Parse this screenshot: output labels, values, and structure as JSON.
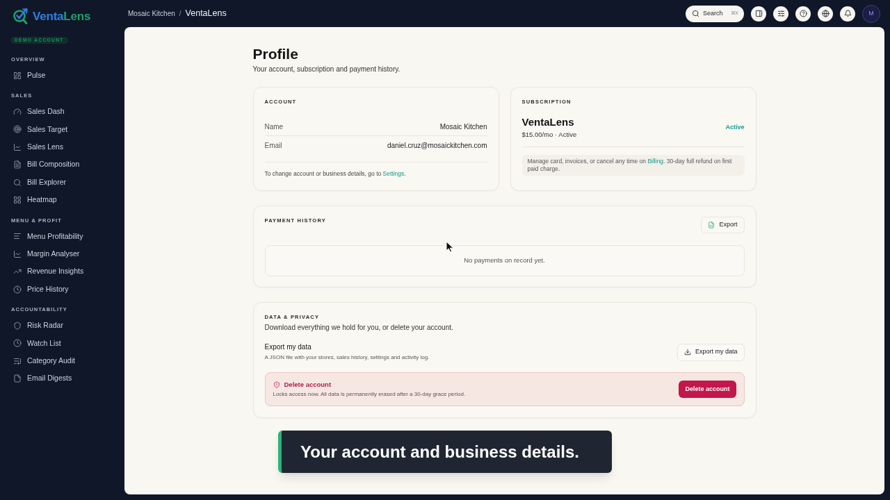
{
  "sidebar": {
    "brand": {
      "lead": "Venta",
      "tail": "Lens"
    },
    "badge": "DEMO ACCOUNT",
    "sections": [
      {
        "title": "OVERVIEW",
        "items": [
          {
            "label": "Pulse"
          }
        ]
      },
      {
        "title": "SALES",
        "items": [
          {
            "label": "Sales Dash"
          },
          {
            "label": "Sales Target"
          },
          {
            "label": "Sales Lens"
          },
          {
            "label": "Bill Composition"
          },
          {
            "label": "Bill Explorer"
          },
          {
            "label": "Heatmap"
          }
        ]
      },
      {
        "title": "MENU & PROFIT",
        "items": [
          {
            "label": "Menu Profitability"
          },
          {
            "label": "Margin Analyser"
          },
          {
            "label": "Revenue Insights"
          },
          {
            "label": "Price History"
          }
        ]
      },
      {
        "title": "ACCOUNTABILITY",
        "items": [
          {
            "label": "Risk Radar"
          },
          {
            "label": "Watch List"
          },
          {
            "label": "Category Audit"
          },
          {
            "label": "Email Digests"
          }
        ]
      }
    ]
  },
  "topbar": {
    "breadcrumb": {
      "parent": "Mosaic Kitchen",
      "separator": "/",
      "current": "VentaLens"
    },
    "search": {
      "label": "Search",
      "shortcut": "⌘K"
    },
    "avatar": "M"
  },
  "page": {
    "title": "Profile",
    "subtitle": "Your account, subscription and payment history."
  },
  "account": {
    "heading": "ACCOUNT",
    "fields": [
      {
        "label": "Name",
        "value": "Mosaic Kitchen"
      },
      {
        "label": "Email",
        "value": "daniel.cruz@mosaickitchen.com"
      }
    ],
    "note": {
      "before": "To change account or business details, go to ",
      "link": "Settings",
      "after": "."
    }
  },
  "subscription": {
    "heading": "SUBSCRIPTION",
    "plan": "VentaLens",
    "price": "$15.00/mo · Active",
    "status": "Active",
    "note": {
      "before": "Manage card, invoices, or cancel any time on ",
      "link": "Billing",
      "after": ". 30-day full refund on first paid charge."
    }
  },
  "payment_history": {
    "heading": "PAYMENT HISTORY",
    "export_button": "Export",
    "empty_message": "No payments on record yet."
  },
  "data_privacy": {
    "heading": "DATA & PRIVACY",
    "description": "Download everything we hold for you, or delete your account.",
    "export": {
      "title": "Export my data",
      "description": "A JSON file with your stores, sales history, settings and activity log.",
      "button": "Export my data"
    },
    "delete": {
      "title": "Delete account",
      "description": "Locks access now. All data is permanently erased after a 30-day grace period.",
      "button": "Delete account"
    }
  },
  "caption": "Your account and business details."
}
